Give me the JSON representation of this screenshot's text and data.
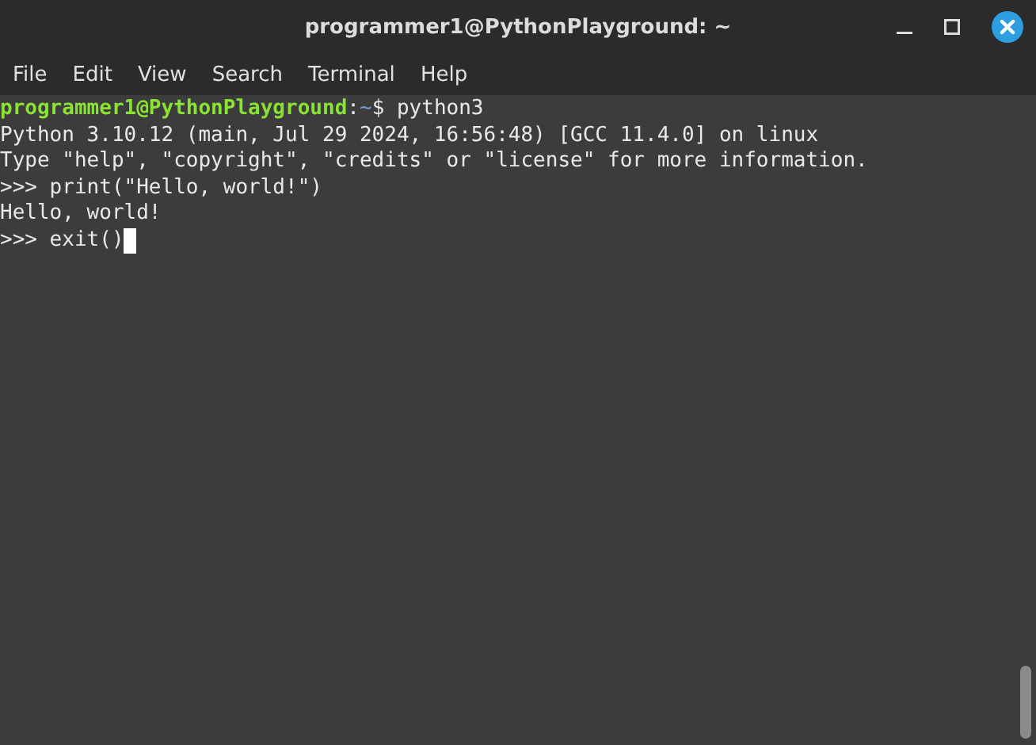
{
  "window": {
    "title": "programmer1@PythonPlayground: ~"
  },
  "menu": [
    "File",
    "Edit",
    "View",
    "Search",
    "Terminal",
    "Help"
  ],
  "terminal": {
    "lines": [
      {
        "segments": [
          {
            "text": "programmer1@PythonPlayground",
            "kind": "host"
          },
          {
            "text": ":",
            "kind": "plain"
          },
          {
            "text": "~",
            "kind": "path"
          },
          {
            "text": "$ python3",
            "kind": "plain"
          }
        ],
        "cursor": false
      },
      {
        "segments": [
          {
            "text": "Python 3.10.12 (main, Jul 29 2024, 16:56:48) [GCC 11.4.0] on linux",
            "kind": "plain"
          }
        ],
        "cursor": false
      },
      {
        "segments": [
          {
            "text": "Type \"help\", \"copyright\", \"credits\" or \"license\" for more information.",
            "kind": "plain"
          }
        ],
        "cursor": false
      },
      {
        "segments": [
          {
            "text": ">>> print(\"Hello, world!\")",
            "kind": "plain"
          }
        ],
        "cursor": false
      },
      {
        "segments": [
          {
            "text": "Hello, world!",
            "kind": "plain"
          }
        ],
        "cursor": false
      },
      {
        "segments": [
          {
            "text": ">>> exit()",
            "kind": "plain"
          }
        ],
        "cursor": true
      }
    ]
  }
}
